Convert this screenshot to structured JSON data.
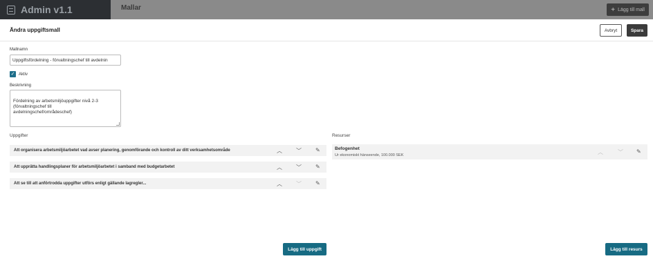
{
  "app": {
    "title": "Admin v1.1"
  },
  "topbar": {
    "section_title": "Mallar",
    "add_button_label": "Lägg till mall"
  },
  "header": {
    "title": "Ändra uppgiftsmall",
    "cancel_label": "Avbryt",
    "save_label": "Spara"
  },
  "form": {
    "name_label": "Mallnamn",
    "name_value": "Uppgiftsfördelning - förvaltningschef till avdelnin",
    "active_label": "Aktiv",
    "active_checked": true,
    "description_label": "Beskrivning",
    "description_value": "Fördelning av arbetsmiljöuppgifter nivå 2-3\n(förvaltningschef till\navdelningschef/områdeschef)"
  },
  "tasks": {
    "title": "Uppgifter",
    "items": [
      {
        "text": "Att organisera arbetsmiljöarbetet vad avser planering, genomförande och kontroll av ditt verksamhetsområde"
      },
      {
        "text": "Att upprätta handlingsplaner för arbetsmiljöarbetet i samband med budgetarbetet"
      },
      {
        "text": "Att se till att anförtrodda uppgifter utförs enligt gällande lagregler..."
      }
    ],
    "add_label": "Lägg till uppgift"
  },
  "resources": {
    "title": "Resurser",
    "items": [
      {
        "title": "Befogenhet",
        "subtitle": "Ur ekonomiskt hänseende, 100.000 SEK"
      }
    ],
    "add_label": "Lägg till resurs"
  },
  "icons": {
    "app": "document-icon",
    "add": "plus-icon",
    "up": "chevron-up-icon",
    "down": "chevron-down-icon",
    "edit": "pencil-icon",
    "check": "checkmark-icon"
  },
  "colors": {
    "primary": "#176b83",
    "checkbox": "#1f6f8b",
    "save": "#3b3b3b"
  }
}
